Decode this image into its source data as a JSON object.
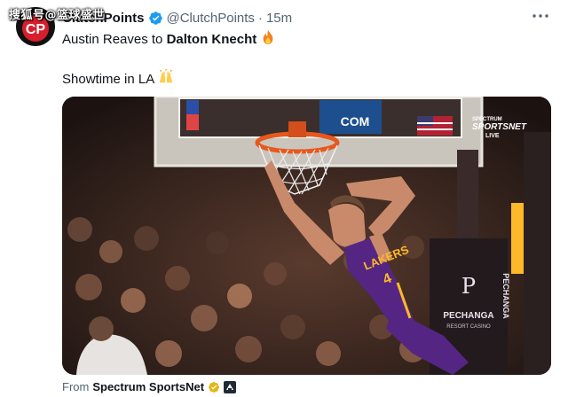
{
  "watermark": "搜狐号@篮球盛世",
  "author": {
    "display_name": "ClutchPoints",
    "handle": "@ClutchPoints",
    "separator": "·",
    "timestamp": "15m",
    "avatar_text": "CP"
  },
  "tweet": {
    "line1_prefix": "Austin Reaves to ",
    "line1_bold": "Dalton Knecht",
    "line1_emoji": "fire-emoji",
    "line2": "Showtime in LA",
    "line2_emoji": "raised-hands-emoji"
  },
  "media": {
    "broadcaster_top": "SPECTRUM",
    "broadcaster_main": "SPORTSNET",
    "broadcaster_live": "LIVE",
    "jersey_text": "LAKERS",
    "jersey_number": "4",
    "sponsor_name": "PECHANGA",
    "sponsor_tagline": "RESORT CASINO",
    "sponsor_vertical": "PECHANGA",
    "backboard_text": "COM",
    "colors": {
      "lakers_purple": "#552583",
      "lakers_gold": "#FDB927",
      "rim_orange": "#E8571C"
    }
  },
  "attribution": {
    "from_label": "From",
    "source_name": "Spectrum SportsNet"
  },
  "colors": {
    "verified_blue": "#1D9BF0",
    "secondary_text": "#536471",
    "primary_text": "#0F1419"
  }
}
